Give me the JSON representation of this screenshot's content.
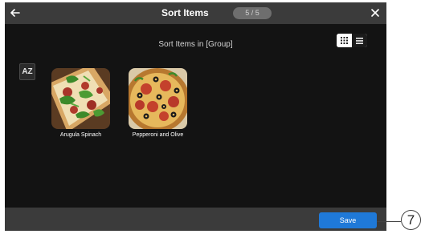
{
  "header": {
    "title": "Sort Items",
    "step": "5 / 5",
    "back_icon": "arrow-left-icon",
    "close_icon": "close-icon"
  },
  "main": {
    "subtitle": "Sort Items in [Group]",
    "view_toggle": {
      "active": "grid",
      "options": [
        "grid",
        "list"
      ]
    },
    "sort_button_label": "AZ",
    "items": [
      {
        "name": "Arugula Spinach",
        "image": "arugula-spinach-pizza"
      },
      {
        "name": "Pepperoni and Olive",
        "image": "pepperoni-olive-pizza"
      }
    ]
  },
  "footer": {
    "save_label": "Save"
  },
  "annotation": {
    "callout": "7"
  },
  "colors": {
    "bar": "#3b3b3b",
    "background": "#131313",
    "accent": "#1f79d8"
  }
}
